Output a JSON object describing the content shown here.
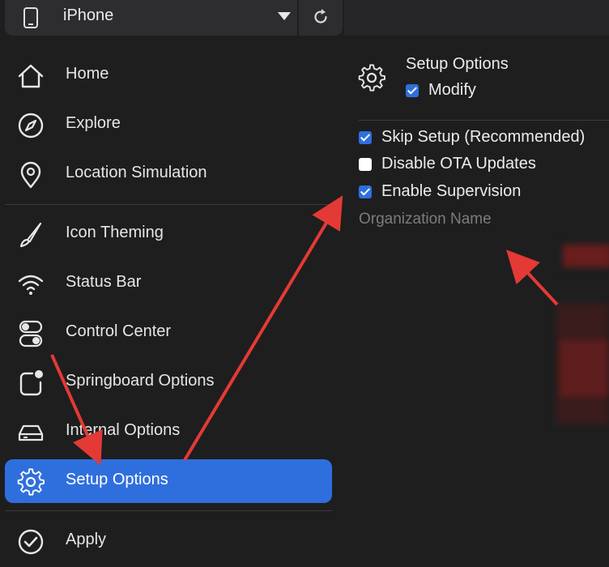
{
  "device_bar": {
    "device_name": "iPhone",
    "icons": {
      "device": "phone-icon",
      "dropdown": "chevron-down-icon",
      "refresh": "refresh-icon"
    }
  },
  "sidebar": {
    "items": [
      {
        "label": "Home",
        "icon": "home-icon"
      },
      {
        "label": "Explore",
        "icon": "compass-icon"
      },
      {
        "label": "Location Simulation",
        "icon": "location-pin-icon"
      },
      {
        "label": "Icon Theming",
        "icon": "brush-icon"
      },
      {
        "label": "Status Bar",
        "icon": "wifi-icon"
      },
      {
        "label": "Control Center",
        "icon": "toggles-icon"
      },
      {
        "label": "Springboard Options",
        "icon": "app-badge-icon"
      },
      {
        "label": "Internal Options",
        "icon": "drive-icon"
      },
      {
        "label": "Setup Options",
        "icon": "gear-icon",
        "active": true
      }
    ],
    "apply": {
      "label": "Apply",
      "icon": "check-circle-icon"
    }
  },
  "setup_panel": {
    "title": "Setup Options",
    "modify_label": "Modify",
    "modify_checked": true,
    "options": [
      {
        "label": "Skip Setup (Recommended)",
        "checked": true
      },
      {
        "label": "Disable OTA Updates",
        "checked": false
      },
      {
        "label": "Enable Supervision",
        "checked": true
      }
    ],
    "organization_name": {
      "placeholder": "Organization Name",
      "value": ""
    }
  },
  "colors": {
    "background": "#1e1e1f",
    "surface": "#2d2d2f",
    "accent": "#2f6fdd",
    "annotation_red": "#e53935"
  }
}
